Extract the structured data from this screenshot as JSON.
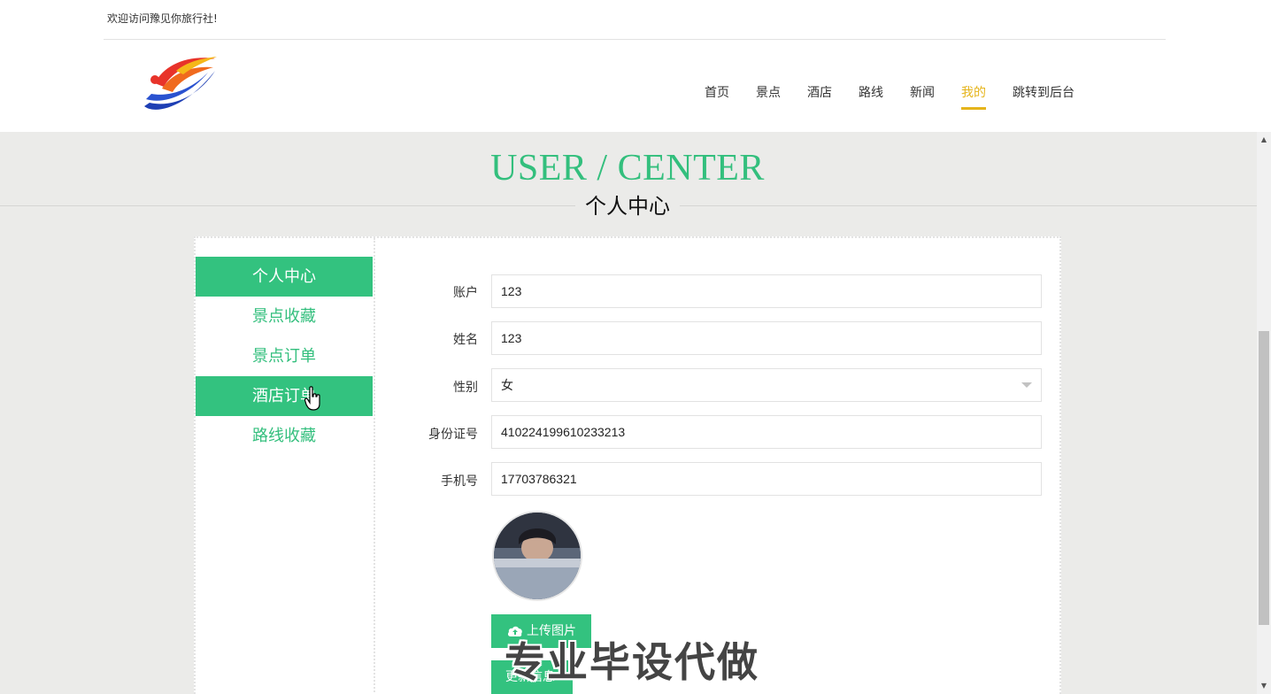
{
  "header": {
    "welcome": "欢迎访问豫见你旅行社!",
    "nav": [
      {
        "label": "首页",
        "active": false
      },
      {
        "label": "景点",
        "active": false
      },
      {
        "label": "酒店",
        "active": false
      },
      {
        "label": "路线",
        "active": false
      },
      {
        "label": "新闻",
        "active": false
      },
      {
        "label": "我的",
        "active": true
      },
      {
        "label": "跳转到后台",
        "active": false
      }
    ],
    "accent_color": "#e5b41b"
  },
  "title": {
    "en": "USER / CENTER",
    "cn": "个人中心",
    "color": "#33bf7d"
  },
  "sidebar": {
    "items": [
      {
        "label": "个人中心",
        "active": true
      },
      {
        "label": "景点收藏",
        "active": false
      },
      {
        "label": "景点订单",
        "active": false
      },
      {
        "label": "酒店订单",
        "active": true
      },
      {
        "label": "路线收藏",
        "active": false
      }
    ]
  },
  "form": {
    "account": {
      "label": "账户",
      "value": "123"
    },
    "name": {
      "label": "姓名",
      "value": "123"
    },
    "gender": {
      "label": "性别",
      "value": "女"
    },
    "id_card": {
      "label": "身份证号",
      "value": "410224199610233213"
    },
    "phone": {
      "label": "手机号",
      "value": "17703786321"
    },
    "upload_label": "上传图片",
    "update_label": "更新信息"
  },
  "watermark": "专业毕设代做",
  "icons": {
    "cloud": "cloud-upload-icon",
    "cursor": "hand-pointer-icon",
    "select": "chevron-down-icon"
  },
  "colors": {
    "primary_green": "#33c27f",
    "background": "#ebebe9"
  }
}
